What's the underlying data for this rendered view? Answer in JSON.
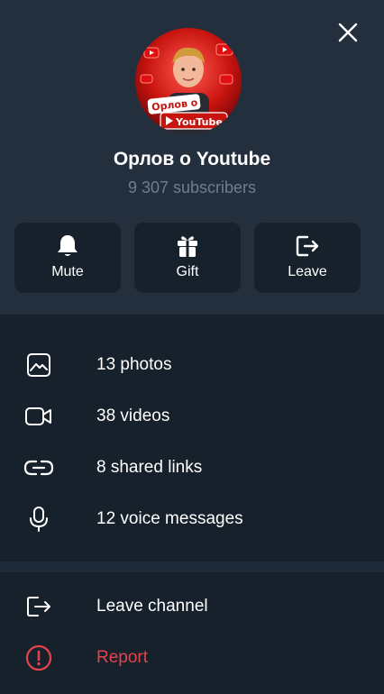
{
  "channel": {
    "name": "Орлов о Youtube",
    "subscribers": "9 307 subscribers",
    "avatar_caption": "Орлов о YouTube"
  },
  "actions": [
    {
      "label": "Mute",
      "icon": "bell-icon"
    },
    {
      "label": "Gift",
      "icon": "gift-icon"
    },
    {
      "label": "Leave",
      "icon": "leave-icon"
    }
  ],
  "media": [
    {
      "label": "13 photos",
      "icon": "photo-icon"
    },
    {
      "label": "38 videos",
      "icon": "video-icon"
    },
    {
      "label": "8 shared links",
      "icon": "link-icon"
    },
    {
      "label": "12 voice messages",
      "icon": "microphone-icon"
    }
  ],
  "footer": [
    {
      "label": "Leave channel",
      "icon": "leave-icon"
    },
    {
      "label": "Report",
      "icon": "report-icon"
    }
  ],
  "colors": {
    "header_bg": "#242f3d",
    "panel_bg": "#17212b",
    "muted_text": "#6d7f8f",
    "danger": "#e5424d"
  }
}
